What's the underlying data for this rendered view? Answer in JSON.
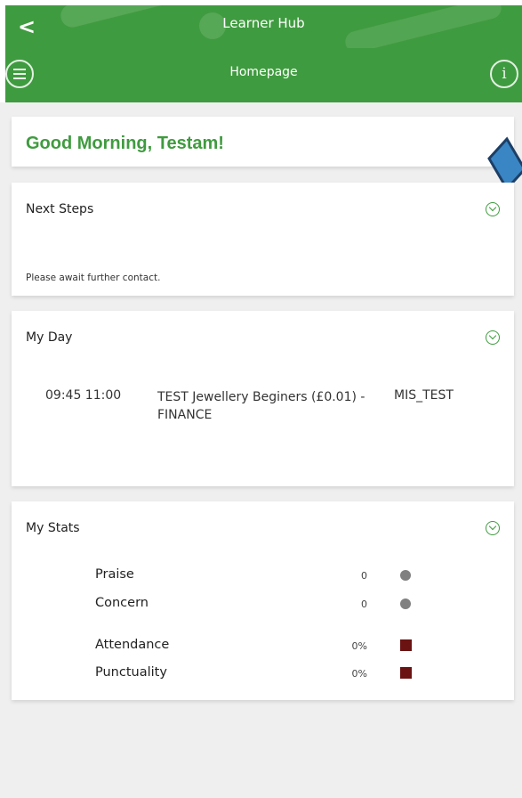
{
  "header": {
    "app_title": "Learner Hub",
    "back_glyph": "<",
    "page_title": "Homepage",
    "info_glyph": "i",
    "color": "#3f9b3f"
  },
  "greeting": {
    "text": "Good Morning, Testam!"
  },
  "next_steps": {
    "title": "Next Steps",
    "message": "Please await further contact."
  },
  "my_day": {
    "title": "My Day",
    "entries": [
      {
        "times": "09:45 11:00",
        "course": "TEST Jewellery Beginers (£0.01) - FINANCE",
        "code": "MIS_TEST"
      }
    ]
  },
  "my_stats": {
    "title": "My Stats",
    "items": [
      {
        "label": "Praise",
        "value": "0",
        "indicator": "dot",
        "color": "#808080"
      },
      {
        "label": "Concern",
        "value": "0",
        "indicator": "dot",
        "color": "#808080"
      },
      {
        "label": "Attendance",
        "value": "0%",
        "indicator": "square",
        "color": "#6b1212"
      },
      {
        "label": "Punctuality",
        "value": "0%",
        "indicator": "square",
        "color": "#6b1212"
      }
    ]
  },
  "icons": {
    "menu": "menu-icon",
    "info": "info-icon",
    "back": "back-chevron-icon",
    "expand": "chevron-down-circle-icon"
  }
}
